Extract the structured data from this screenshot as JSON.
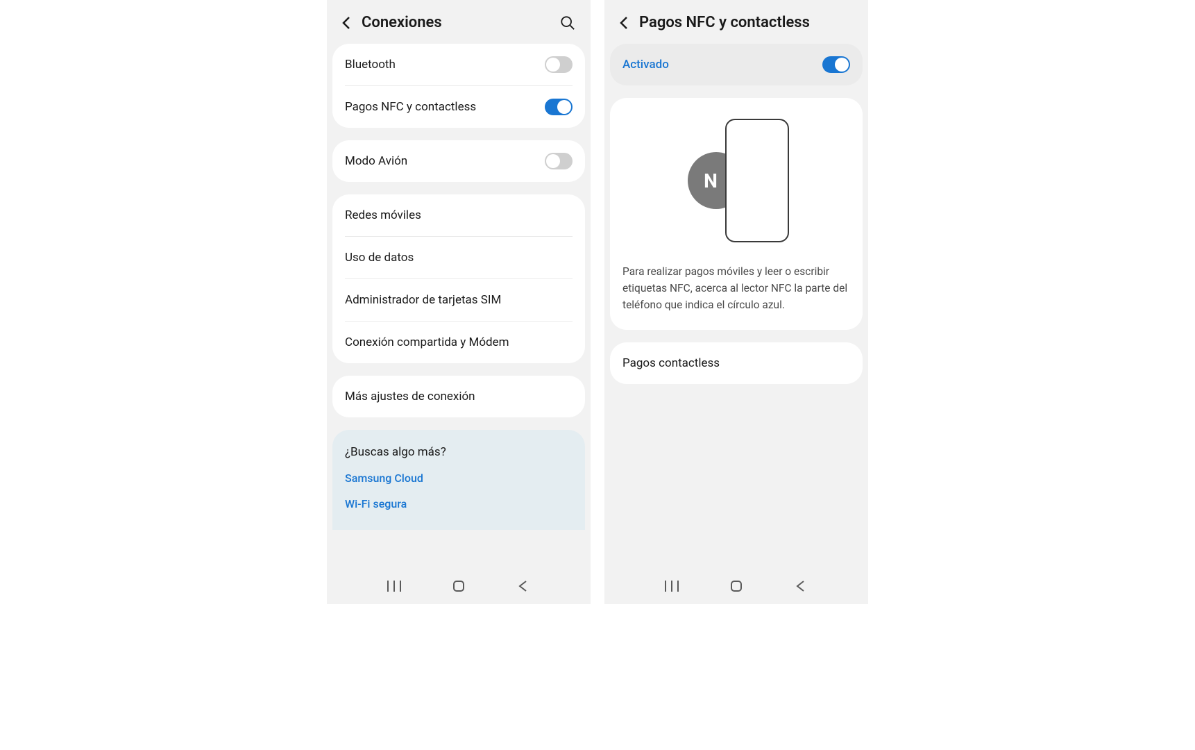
{
  "screen_left": {
    "title": "Conexiones",
    "group1": {
      "bluetooth": {
        "label": "Bluetooth",
        "on": false
      },
      "nfc": {
        "label": "Pagos NFC y contactless",
        "on": true
      }
    },
    "group2": {
      "airplane": {
        "label": "Modo Avión",
        "on": false
      }
    },
    "group3": {
      "mobile_networks": "Redes móviles",
      "data_usage": "Uso de datos",
      "sim_manager": "Administrador de tarjetas SIM",
      "tethering": "Conexión compartida y Módem"
    },
    "group4": {
      "more_settings": "Más ajustes de conexión"
    },
    "suggest": {
      "title": "¿Buscas algo más?",
      "links": [
        "Samsung Cloud",
        "Wi-Fi segura"
      ]
    }
  },
  "screen_right": {
    "title": "Pagos NFC y contactless",
    "activated": {
      "label": "Activado",
      "on": true
    },
    "description": "Para realizar pagos móviles y leer o escribir etiquetas NFC, acerca al lector NFC la parte del teléfono que indica el círculo azul.",
    "contactless_payments": "Pagos contactless"
  }
}
